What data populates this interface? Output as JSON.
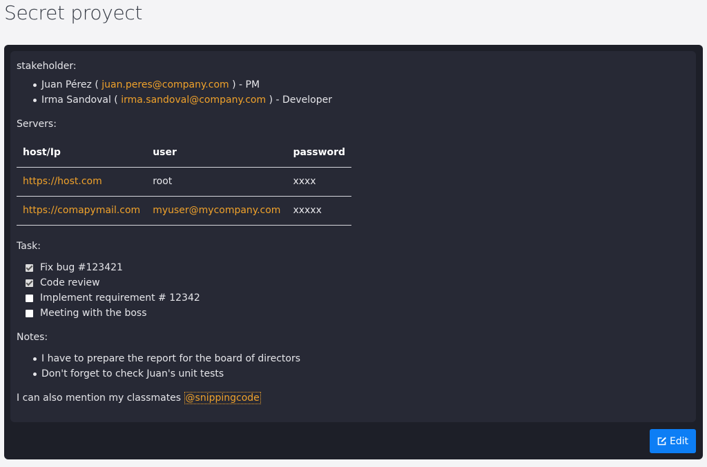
{
  "page": {
    "title": "Secret proyect"
  },
  "stakeholders": {
    "label": "stakeholder:",
    "items": [
      {
        "name": "Juan Pérez (",
        "email": "juan.peres@company.com",
        "suffix": ") - PM"
      },
      {
        "name": "Irma Sandoval (",
        "email": "irma.sandoval@company.com",
        "suffix": ") - Developer"
      }
    ]
  },
  "servers": {
    "label": "Servers:",
    "headers": [
      "host/Ip",
      "user",
      "password"
    ],
    "rows": [
      {
        "host": "https://host.com",
        "user": "root",
        "password": "xxxx"
      },
      {
        "host": "https://comapymail.com",
        "user": "myuser@mycompany.com",
        "password": "xxxxx"
      }
    ]
  },
  "tasks": {
    "label": "Task:",
    "items": [
      {
        "label": "Fix bug #123421",
        "checked": true
      },
      {
        "label": "Code review",
        "checked": true
      },
      {
        "label": "Implement requirement # 12342",
        "checked": false
      },
      {
        "label": "Meeting with the boss",
        "checked": false
      }
    ]
  },
  "notes": {
    "label": "Notes:",
    "items": [
      "I have to prepare the report for the board of directors",
      "Don't forget to check Juan's unit tests"
    ]
  },
  "mention": {
    "text": "I can also mention my classmates ",
    "handle": "@snippingcode"
  },
  "actions": {
    "edit_label": "Edit",
    "edit_icon": "edit-icon"
  },
  "colors": {
    "accent": "#f0a22b",
    "primary_button": "#0d7ef5",
    "panel": "#1d1f28",
    "content": "#272935"
  }
}
